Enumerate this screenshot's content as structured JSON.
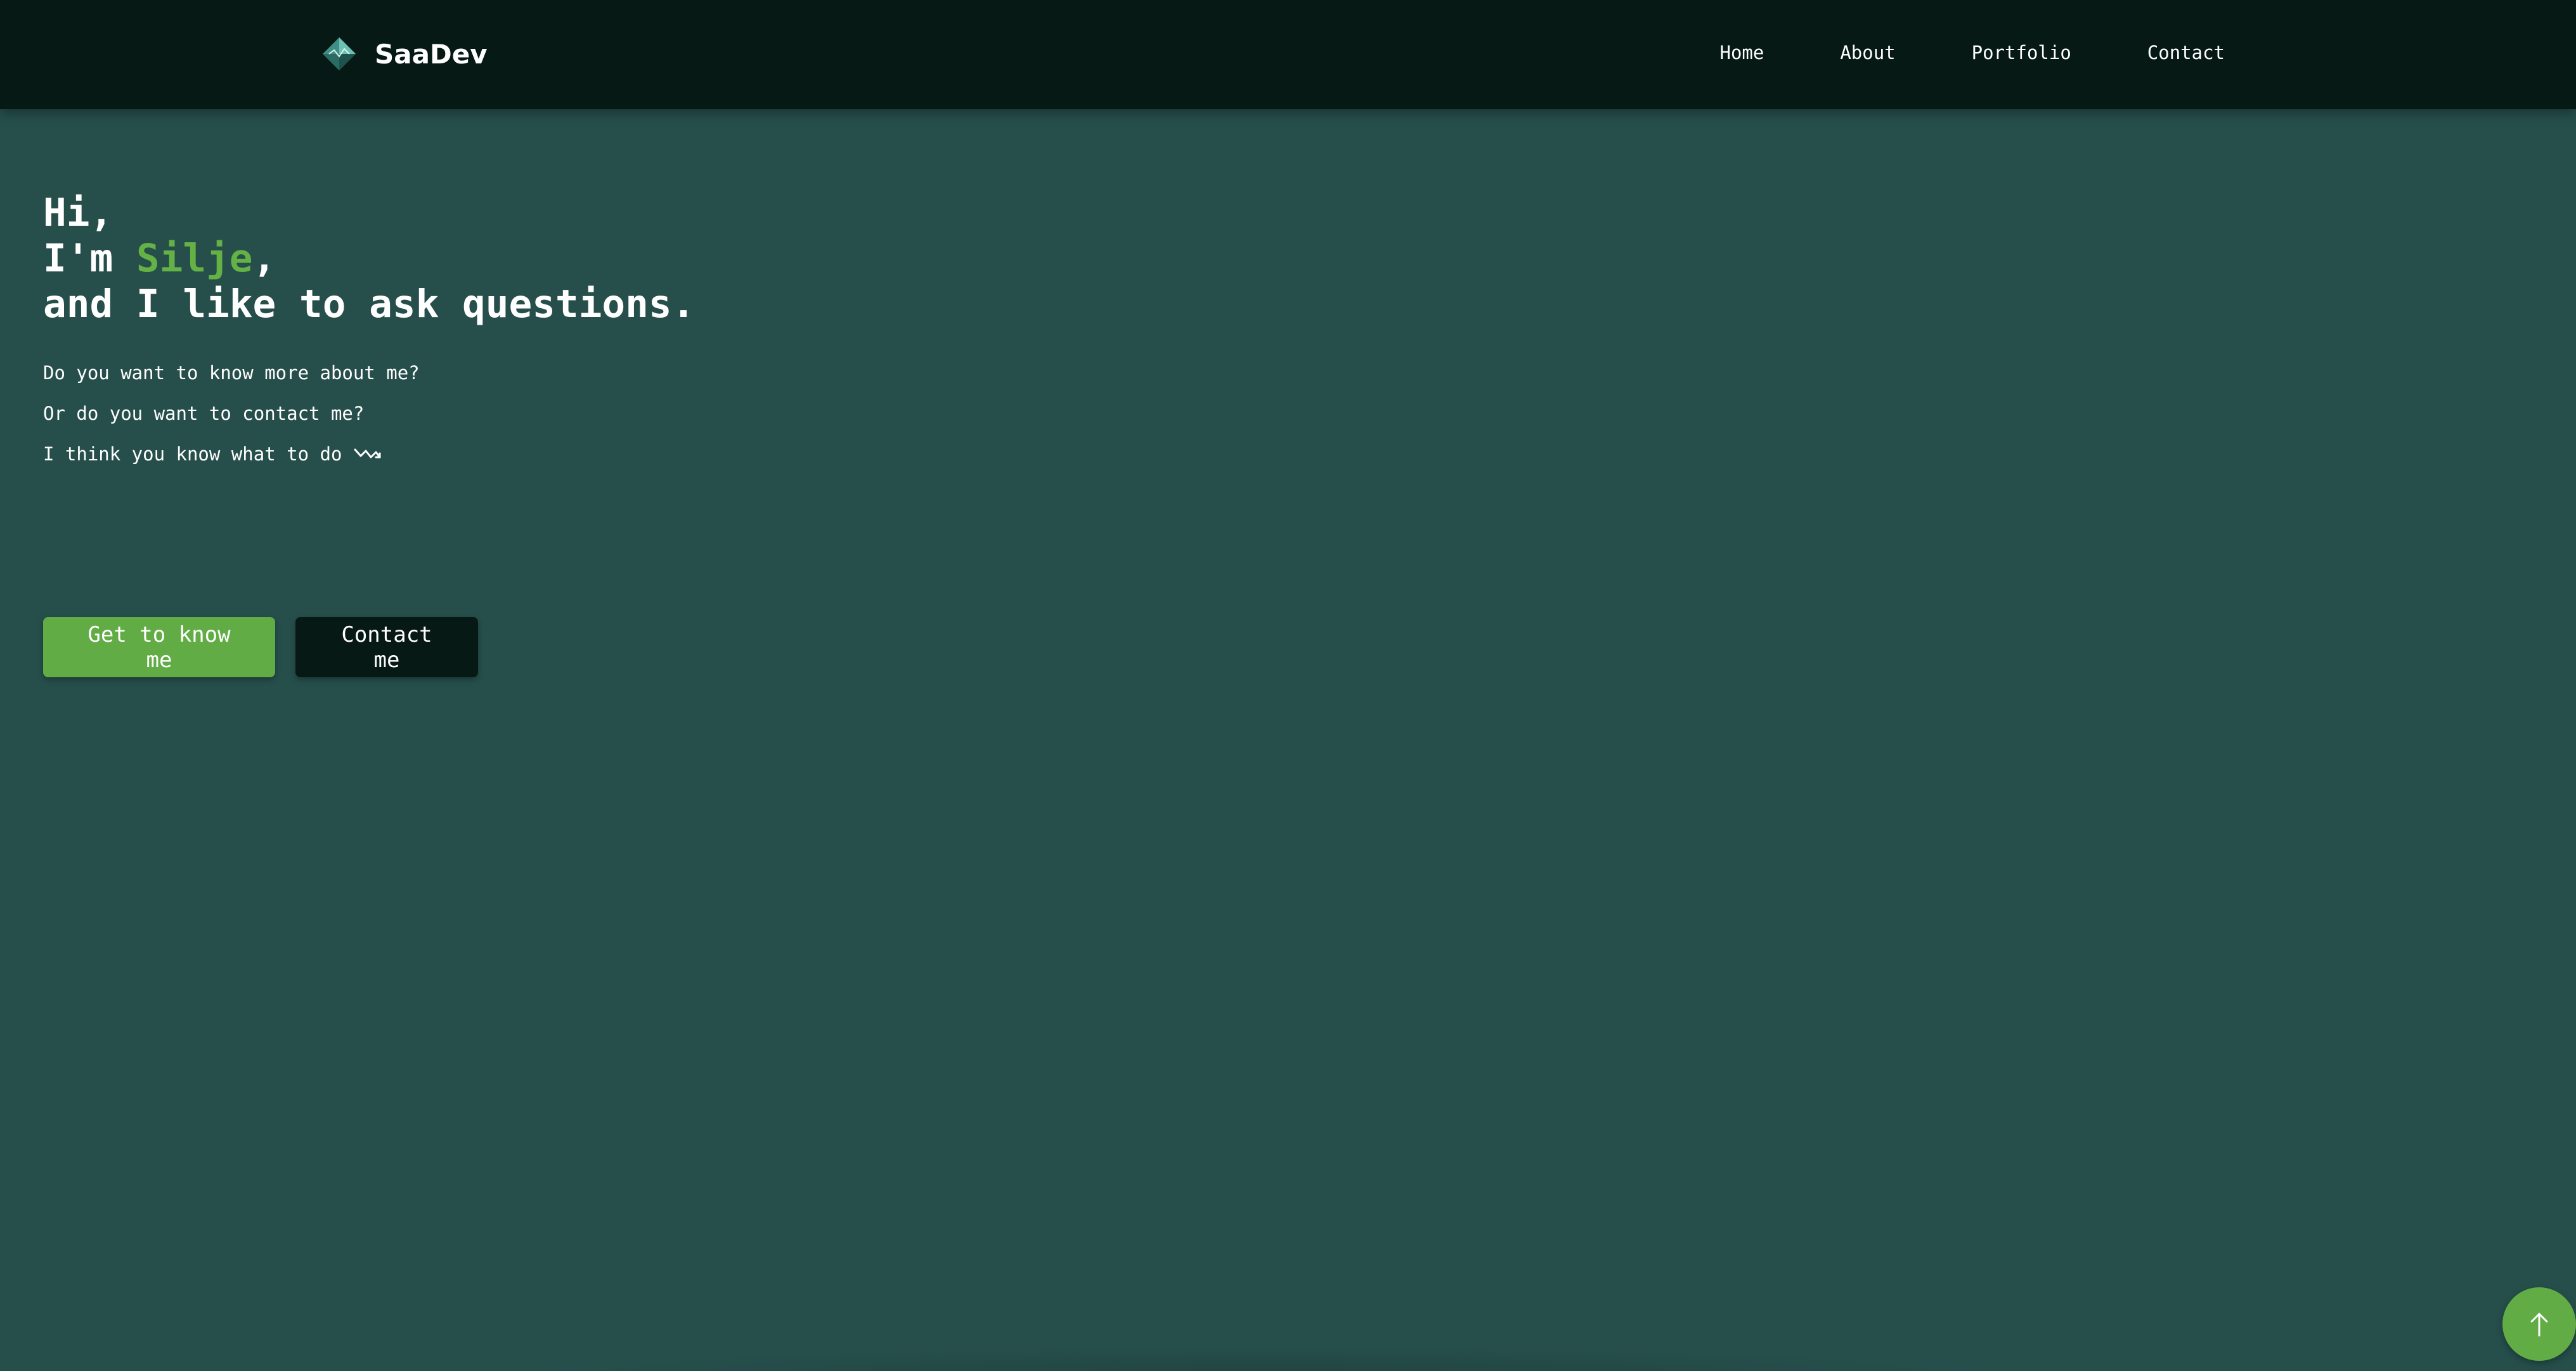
{
  "navbar": {
    "brand": {
      "name": "SaaDev",
      "logo_icon": "crystal-diamond-icon"
    },
    "items": [
      {
        "label": "Home"
      },
      {
        "label": "About"
      },
      {
        "label": "Portfolio"
      },
      {
        "label": "Contact"
      }
    ]
  },
  "hero": {
    "greeting": "Hi,",
    "intro_prefix": "I'm ",
    "name": "Silje",
    "intro_suffix": ",",
    "tagline": "and I like to ask questions.",
    "lines": [
      "Do you want to know more about me?",
      "Or do you want to contact me?",
      "I think you know what to do"
    ],
    "hint_icon": "squiggle-arrow-down-icon"
  },
  "buttons": {
    "primary_label": "Get to know me",
    "secondary_label": "Contact me"
  },
  "scroll_top": {
    "icon": "arrow-up-icon"
  },
  "colors": {
    "background": "#264f4c",
    "navbar": "#061914",
    "accent": "#64b245",
    "text": "#ffffff"
  }
}
